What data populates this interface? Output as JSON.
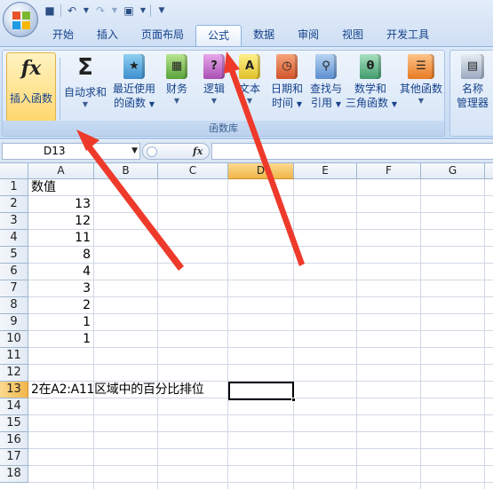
{
  "quick_access": {
    "save_icon": "save-icon",
    "undo_icon": "undo-icon",
    "redo_icon": "redo-icon",
    "print_preview_icon": "print-preview-icon",
    "customize_icon": "customize-icon"
  },
  "tabs": [
    "开始",
    "插入",
    "页面布局",
    "公式",
    "数据",
    "审阅",
    "视图",
    "开发工具"
  ],
  "active_tab": "公式",
  "ribbon": {
    "group_label": "函数库",
    "insert_function": "插入函数",
    "autosum": [
      "自动求和",
      ""
    ],
    "recent": [
      "最近使用",
      "的函数"
    ],
    "financial": [
      "财务",
      ""
    ],
    "logical": [
      "逻辑",
      ""
    ],
    "text": [
      "文本",
      ""
    ],
    "datetime": [
      "日期和",
      "时间"
    ],
    "lookup": [
      "查找与",
      "引用"
    ],
    "math": [
      "数学和",
      "三角函数"
    ],
    "more": [
      "其他函数",
      ""
    ],
    "name_manager": [
      "名称",
      "管理器"
    ]
  },
  "formula_bar": {
    "name_box": "D13",
    "fx": "fx",
    "formula": ""
  },
  "columns": [
    "A",
    "B",
    "C",
    "D",
    "E",
    "F",
    "G"
  ],
  "selected_column": "D",
  "rows": [
    "1",
    "2",
    "3",
    "4",
    "5",
    "6",
    "7",
    "8",
    "9",
    "10",
    "11",
    "12",
    "13",
    "14",
    "15",
    "16",
    "17",
    "18"
  ],
  "selected_row": "13",
  "cells": {
    "A1": "数值",
    "A2": "13",
    "A3": "12",
    "A4": "11",
    "A5": "8",
    "A6": "4",
    "A7": "3",
    "A8": "2",
    "A9": "1",
    "A10": "1",
    "A13": "2在A2:A11区域中的百分比排位"
  },
  "colors": {
    "accent": "#15428b",
    "arrow": "#f0392b",
    "selected_header": "#f2b64b"
  }
}
